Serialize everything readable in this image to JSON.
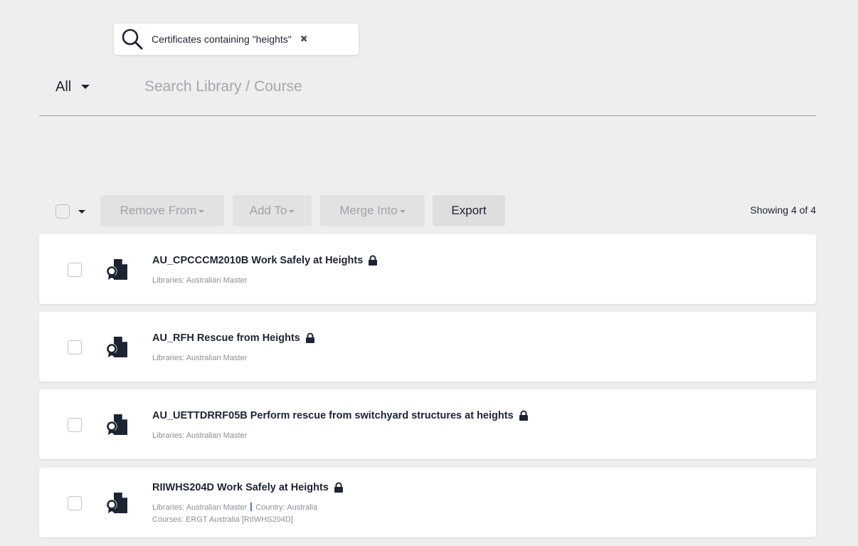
{
  "search_chip": {
    "text": "Certificates containing \"heights\"",
    "close_glyph": "✖"
  },
  "filter": {
    "selected": "All",
    "placeholder": "Search Library / Course"
  },
  "toolbar": {
    "remove_from": "Remove From",
    "add_to": "Add To",
    "merge_into": "Merge Into",
    "export": "Export",
    "showing": "Showing 4 of 4"
  },
  "results": [
    {
      "title": "AU_CPCCCM2010B Work Safely at Heights",
      "libraries": "Libraries: Australian Master"
    },
    {
      "title": "AU_RFH Rescue from Heights",
      "libraries": "Libraries: Australian Master"
    },
    {
      "title": "AU_UETTDRRF05B Perform rescue from switchyard structures at heights",
      "libraries": "Libraries: Australian Master"
    },
    {
      "title": "RIIWHS204D Work Safely at Heights",
      "libraries": "Libraries: Australian Master",
      "country": "Country: Australia",
      "courses": "Courses: ERGT Australia [RIIWHS204D]"
    }
  ],
  "icons": {
    "search": "search-icon",
    "close": "close-icon",
    "certificate": "certificate-icon",
    "lock": "lock-icon"
  }
}
